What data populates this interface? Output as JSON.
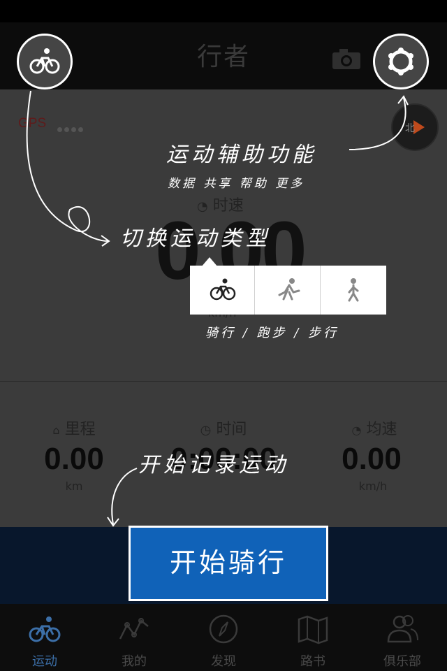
{
  "app": {
    "title": "行者"
  },
  "gps": {
    "label": "GPS"
  },
  "speed": {
    "label": "时速",
    "value": "0.00",
    "unit": "km/h"
  },
  "stats": [
    {
      "label": "里程",
      "value": "0.00",
      "unit": "km"
    },
    {
      "label": "时间",
      "value": "0:00:00",
      "unit": ""
    },
    {
      "label": "均速",
      "value": "0.00",
      "unit": "km/h"
    }
  ],
  "start_button": {
    "label": "开始骑行"
  },
  "tabs": [
    {
      "label": "运动",
      "icon": "bike-icon",
      "active": true
    },
    {
      "label": "我的",
      "icon": "chart-line-icon",
      "active": false
    },
    {
      "label": "发现",
      "icon": "compass-icon",
      "active": false
    },
    {
      "label": "路书",
      "icon": "map-icon",
      "active": false
    },
    {
      "label": "俱乐部",
      "icon": "people-icon",
      "active": false
    }
  ],
  "sport_types": [
    {
      "name": "cycling",
      "icon": "bike-icon"
    },
    {
      "name": "running",
      "icon": "runner-icon"
    },
    {
      "name": "walking",
      "icon": "walker-icon"
    }
  ],
  "annotations": {
    "assist_title": "运动辅助功能",
    "assist_sub": "数据 共享 帮助 更多",
    "switch_type": "切换运动类型",
    "types": "骑行 / 跑步 / 步行",
    "start_record": "开始记录运动"
  },
  "colors": {
    "accent": "#1062b8",
    "bottom_bar": "#08172c",
    "active_tab": "#3c6fa8"
  }
}
